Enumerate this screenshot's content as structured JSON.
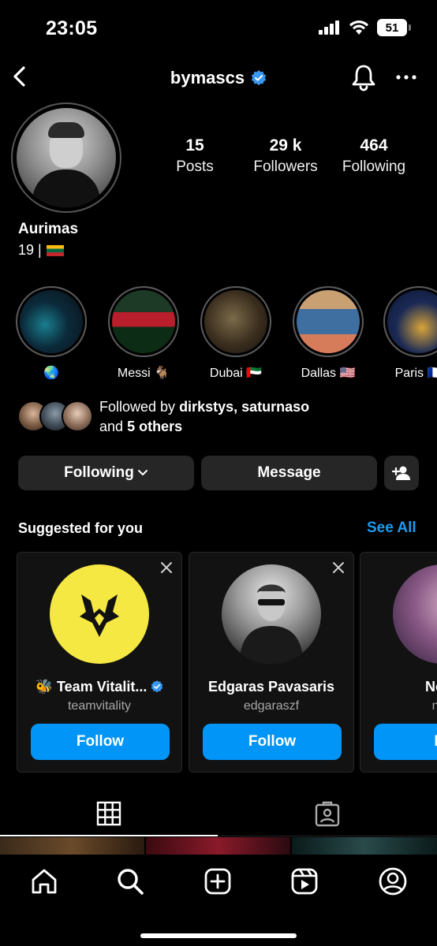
{
  "status_bar": {
    "time": "23:05",
    "battery": "51",
    "icons": [
      "signal-icon",
      "wifi-icon",
      "battery-icon"
    ]
  },
  "header": {
    "username": "bymascs",
    "verified": true
  },
  "profile": {
    "stats": [
      {
        "value": "15",
        "label": "Posts"
      },
      {
        "value": "29 k",
        "label": "Followers"
      },
      {
        "value": "464",
        "label": "Following"
      }
    ],
    "display_name": "Aurimas",
    "bio": "19 |"
  },
  "highlights": [
    {
      "label": "🌏",
      "colors": [
        "#0b2a3a",
        "#1a7d8e",
        "#0a1016"
      ]
    },
    {
      "label": "Messi 🐐",
      "colors": [
        "#1c3a25",
        "#b81e2b",
        "#0d2c16"
      ]
    },
    {
      "label": "Dubai 🇦🇪",
      "colors": [
        "#3a2d1d",
        "#7a6a4a",
        "#14120e"
      ]
    },
    {
      "label": "Dallas 🇺🇸",
      "colors": [
        "#c9a071",
        "#3f6fa0",
        "#d77c5a"
      ]
    },
    {
      "label": "Paris 🇫🇷",
      "colors": [
        "#1b2a55",
        "#d8a43a",
        "#0b1330"
      ]
    }
  ],
  "followed_by": {
    "prefix": "Followed by",
    "names": "dirkstys, saturnaso",
    "and": "and",
    "others": "5 others"
  },
  "actions": {
    "following_label": "Following",
    "message_label": "Message"
  },
  "suggested": {
    "title": "Suggested for you",
    "see_all": "See All",
    "cards": [
      {
        "name": "🐝 Team Vitalit...",
        "handle": "teamvitality",
        "follow": "Follow",
        "verified": true
      },
      {
        "name": "Edgaras Pavasaris",
        "handle": "edgaraszf",
        "follow": "Follow",
        "verified": false
      },
      {
        "name": "Noa I",
        "handle": "noa",
        "follow": "Fo",
        "verified": false
      }
    ]
  },
  "colors": {
    "accent": "#0095f6",
    "link": "#1b9bf0",
    "verified": "#3897f0",
    "button_bg": "#262626",
    "vitality_yellow": "#f5e843"
  }
}
